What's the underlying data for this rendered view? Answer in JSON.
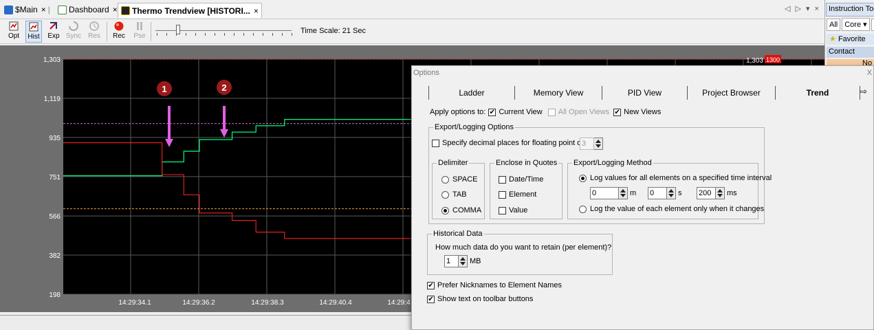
{
  "tabs": [
    {
      "label": "$Main",
      "icon": "main-program-icon",
      "active": false
    },
    {
      "label": "Dashboard",
      "icon": "dashboard-icon",
      "active": false
    },
    {
      "label": "Thermo Trendview [HISTORI...",
      "icon": "trendview-icon",
      "active": true
    }
  ],
  "tab_close_glyph": "×",
  "tab_controls": "◁ ▷ ▾ ×",
  "toolbar": {
    "buttons": [
      {
        "label": "Opt",
        "icon": "options-icon",
        "state": "normal"
      },
      {
        "label": "Hist",
        "icon": "history-icon",
        "state": "pressed"
      },
      {
        "label": "Exp",
        "icon": "export-icon",
        "state": "normal"
      },
      {
        "label": "Sync",
        "icon": "sync-icon",
        "state": "disabled"
      },
      {
        "label": "Res",
        "icon": "reset-icon",
        "state": "disabled"
      },
      {
        "label": "Rec",
        "icon": "record-icon",
        "state": "normal"
      },
      {
        "label": "Pse",
        "icon": "pause-icon",
        "state": "disabled"
      }
    ],
    "time_scale": "Time Scale: 21 Sec"
  },
  "chart_data": {
    "type": "line",
    "y_ticks": [
      "1,303",
      "1,119",
      "935",
      "751",
      "566",
      "382",
      "198"
    ],
    "ylim": [
      198,
      1303
    ],
    "x_ticks": [
      "14:29:34.1",
      "14:29:36.2",
      "14:29:38.3",
      "14:29:40.4",
      "14:29:4"
    ],
    "top_right_value": "1,303",
    "top_right_badge": "1300",
    "markers": [
      "1",
      "2"
    ],
    "reference_lines": [
      {
        "value": 1303,
        "color": "#e04040"
      },
      {
        "value": 1000,
        "color": "#d070d0"
      },
      {
        "value": 600,
        "color": "#e8a040"
      }
    ],
    "series": [
      {
        "color": "#00ff80",
        "steps": [
          [
            0,
            755
          ],
          [
            0.4,
            820
          ],
          [
            0.72,
            870
          ],
          [
            0.95,
            925
          ],
          [
            1.43,
            960
          ],
          [
            1.78,
            990
          ],
          [
            2.2,
            1020
          ]
        ]
      },
      {
        "color": "#e02020",
        "steps": [
          [
            0,
            910
          ],
          [
            0.4,
            760
          ],
          [
            0.72,
            665
          ],
          [
            0.95,
            580
          ],
          [
            1.43,
            545
          ],
          [
            1.78,
            490
          ],
          [
            2.2,
            460
          ]
        ]
      }
    ]
  },
  "instruction_panel": {
    "title": "Instruction Too",
    "filters": [
      "All",
      "Core ▾",
      "C"
    ],
    "favorites": "Favorite",
    "contact": "Contact",
    "row": "No"
  },
  "options": {
    "title": "Options",
    "close": "X",
    "tabs": [
      "Ladder",
      "Memory View",
      "PID View",
      "Project Browser",
      "Trend"
    ],
    "tab_arrow": "⇨",
    "apply_label": "Apply options to:",
    "apply": [
      {
        "label": "Current View",
        "checked": true,
        "enabled": true
      },
      {
        "label": "All Open Views",
        "checked": false,
        "enabled": false
      },
      {
        "label": "New Views",
        "checked": true,
        "enabled": true
      }
    ],
    "export_group": "Export/Logging Options",
    "decimal_label": "Specify decimal places for floating point data",
    "decimal_value": "3",
    "delimiter_group": "Delimiter",
    "delimiters": [
      {
        "label": "SPACE",
        "selected": false
      },
      {
        "label": "TAB",
        "selected": false
      },
      {
        "label": "COMMA",
        "selected": true
      }
    ],
    "enclose_group": "Enclose in Quotes",
    "enclose": [
      {
        "label": "Date/Time",
        "checked": false
      },
      {
        "label": "Element",
        "checked": false
      },
      {
        "label": "Value",
        "checked": false
      }
    ],
    "method_group": "Export/Logging Method",
    "method_interval": "Log values for all elements on a specified time interval",
    "method_change": "Log the value of each element only when it changes",
    "interval_values": [
      {
        "value": "0",
        "unit": "m"
      },
      {
        "value": "0",
        "unit": "s"
      },
      {
        "value": "200",
        "unit": "ms"
      }
    ],
    "historical_group": "Historical Data",
    "historical_question": "How much data do you want to retain (per element)?",
    "historical_value": "1",
    "historical_unit": "MB",
    "prefer_nicknames": "Prefer Nicknames to Element Names",
    "show_text": "Show text on toolbar buttons"
  }
}
